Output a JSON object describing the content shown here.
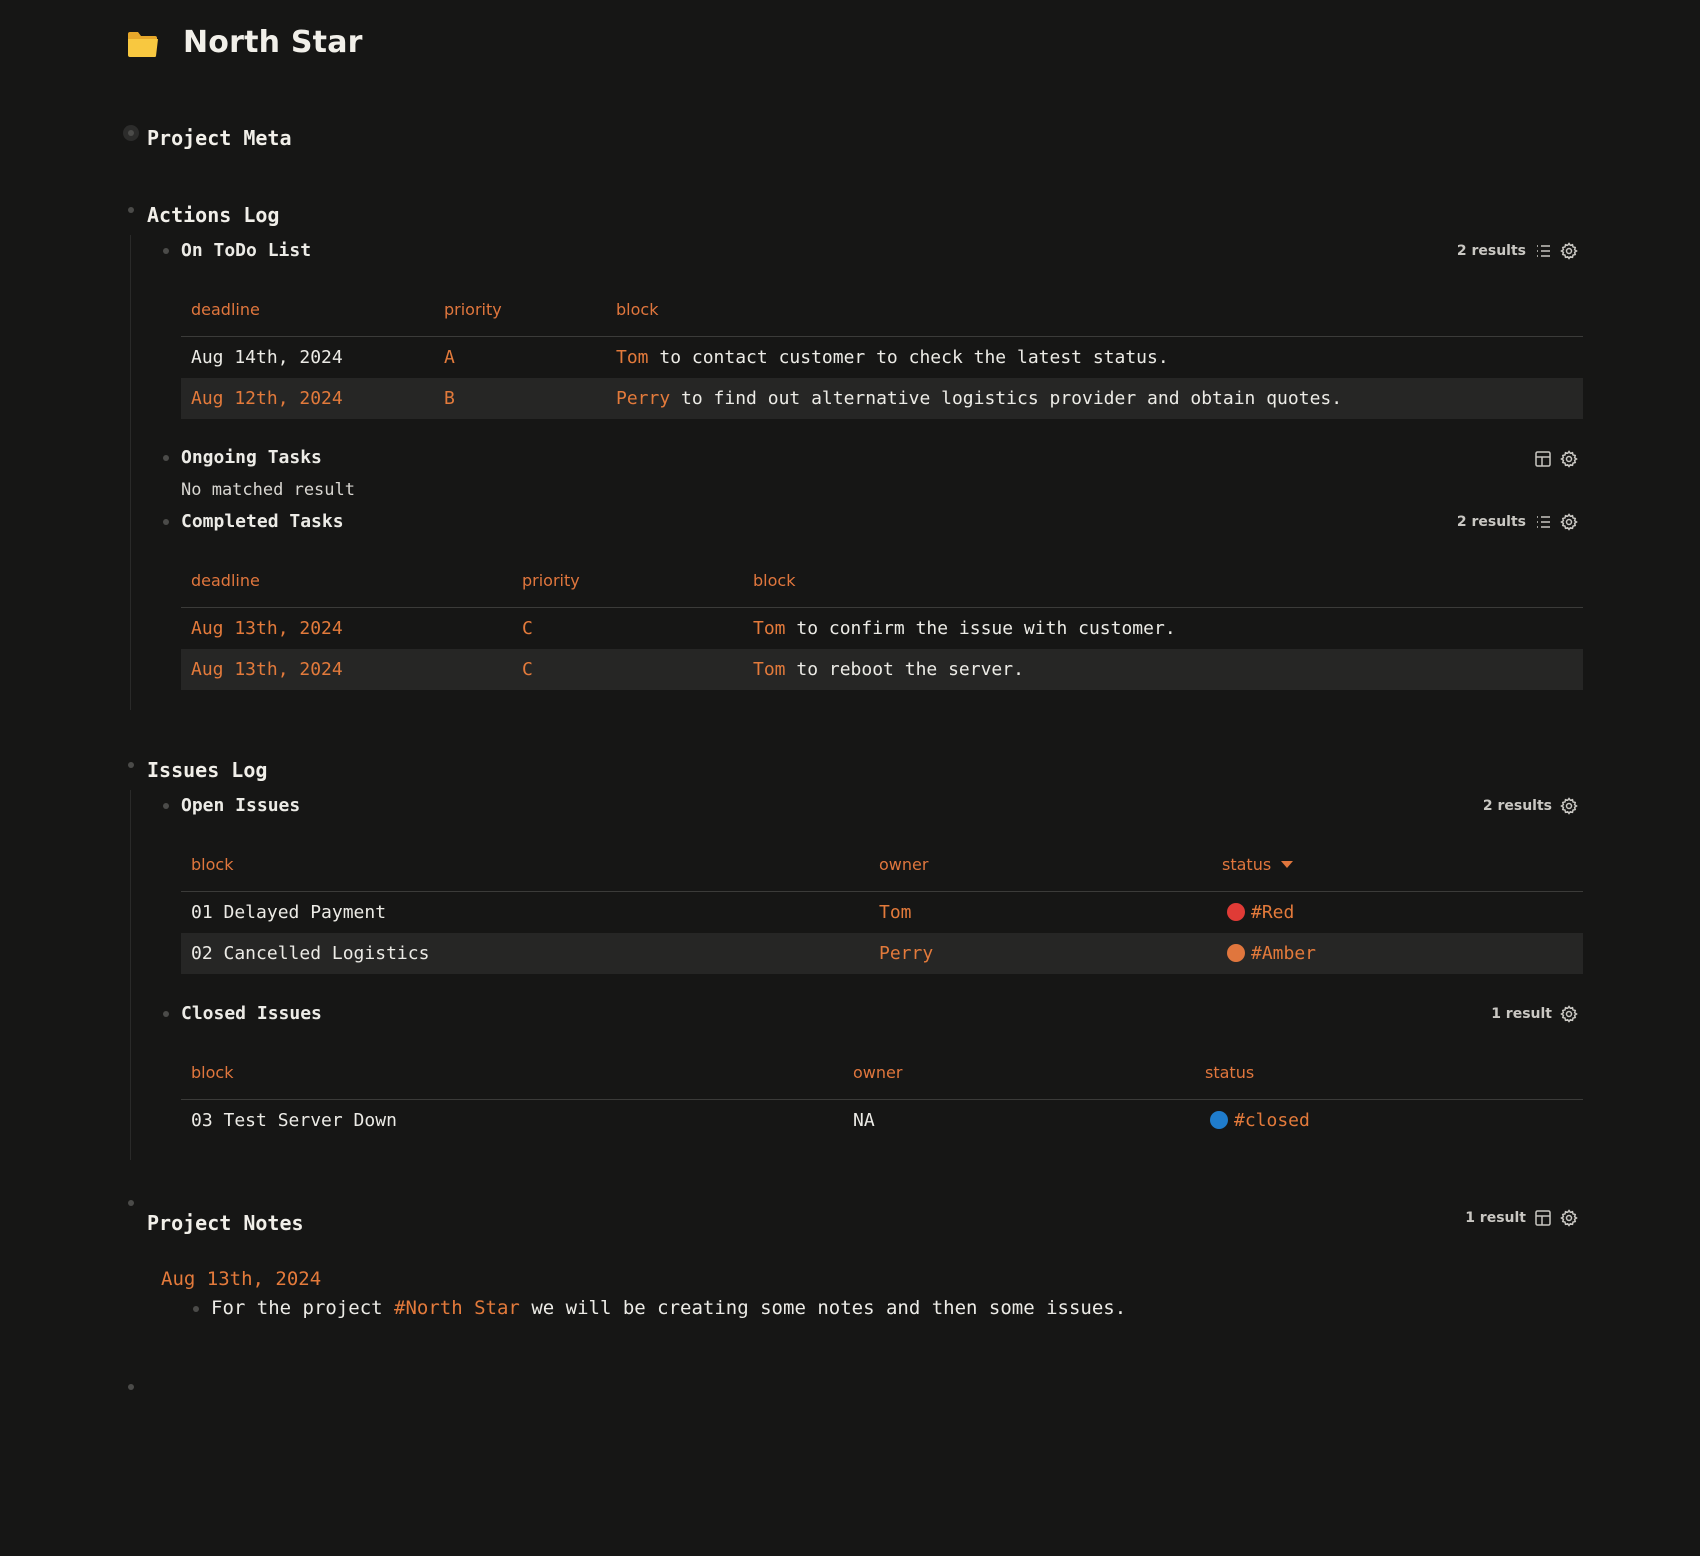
{
  "page": {
    "title": "North Star"
  },
  "sections": {
    "project_meta": "Project Meta",
    "actions_log": "Actions Log",
    "issues_log": "Issues Log",
    "project_notes": "Project Notes"
  },
  "todo": {
    "title": "On ToDo List",
    "count": "2 results",
    "columns": [
      "deadline",
      "priority",
      "block"
    ],
    "rows": [
      {
        "deadline": "Aug 14th, 2024",
        "priority": "A",
        "owner": "Tom",
        "text": "to contact customer to check the latest status."
      },
      {
        "deadline": "Aug 12th, 2024",
        "priority": "B",
        "owner": "Perry",
        "text": "to find out alternative logistics provider and obtain quotes."
      }
    ]
  },
  "ongoing": {
    "title": "Ongoing Tasks",
    "empty": "No matched result"
  },
  "completed": {
    "title": "Completed Tasks",
    "count": "2 results",
    "columns": [
      "deadline",
      "priority",
      "block"
    ],
    "rows": [
      {
        "deadline": "Aug 13th, 2024",
        "priority": "C",
        "owner": "Tom",
        "text": "to confirm the issue with customer."
      },
      {
        "deadline": "Aug 13th, 2024",
        "priority": "C",
        "owner": "Tom",
        "text": "to reboot the server."
      }
    ]
  },
  "open_issues": {
    "title": "Open Issues",
    "count": "2 results",
    "columns": [
      "block",
      "owner",
      "status"
    ],
    "rows": [
      {
        "block": "01 Delayed Payment",
        "owner": "Tom",
        "status": "#Red",
        "status_color": "#e03b36"
      },
      {
        "block": "02 Cancelled Logistics",
        "owner": "Perry",
        "status": "#Amber",
        "status_color": "#e0763d"
      }
    ]
  },
  "closed_issues": {
    "title": "Closed Issues",
    "count": "1 result",
    "columns": [
      "block",
      "owner",
      "status"
    ],
    "rows": [
      {
        "block": "03 Test Server Down",
        "owner": "NA",
        "status": "#closed",
        "status_color": "#1f7ccc"
      }
    ]
  },
  "notes": {
    "count": "1 result",
    "date": "Aug 13th, 2024",
    "text_before": "For the project",
    "tag": "#North Star",
    "text_after": "we will be creating some notes and then some issues."
  },
  "colors": {
    "accent": "#e37a3b",
    "background": "#161615",
    "folder": "#f6c33c"
  }
}
